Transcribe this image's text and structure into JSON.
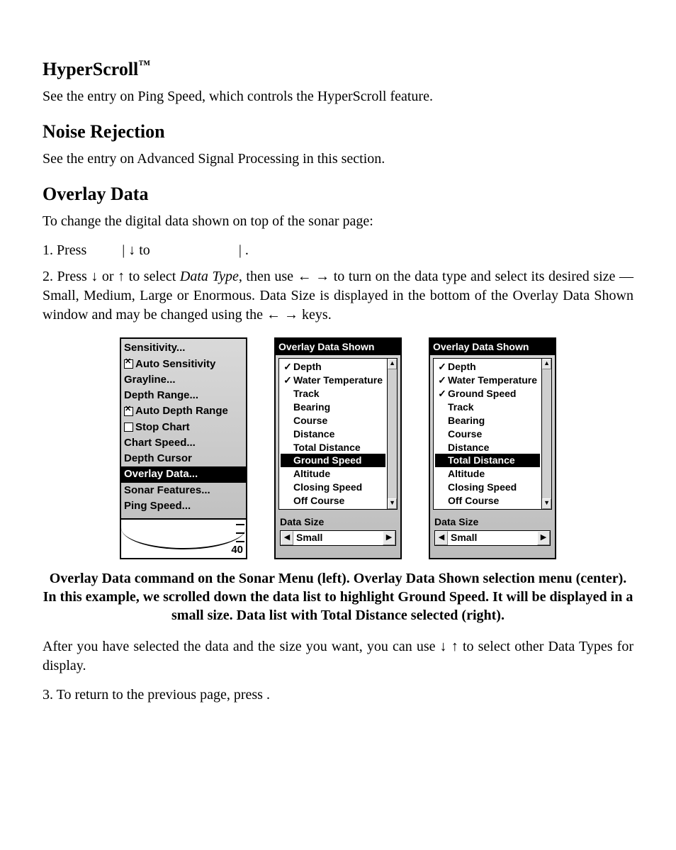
{
  "headings": {
    "hyperscroll": "HyperScroll",
    "tm": "™",
    "noise": "Noise Rejection",
    "overlay": "Overlay Data"
  },
  "paragraphs": {
    "hyperscroll_body": "See the entry on Ping Speed, which controls the HyperScroll feature.",
    "noise_body": "See the entry on Advanced Signal Processing in this section.",
    "overlay_intro": "To change the digital data shown on top of the sonar page:",
    "step1_a": "1. Press ",
    "step1_b": "|",
    "step1_c": "↓ to ",
    "step1_d": "|",
    "step1_e": "     .",
    "step2_a": "2. Press ↓ or ↑ to select ",
    "step2_datatype": "Data Type",
    "step2_b": ", then use ← → to turn on the data type and select its desired size — Small, Medium, Large or Enormous. Data Size is displayed in the bottom of the Overlay Data Shown window and may be changed using the ← → keys.",
    "after_a": "After you have selected the data and the size you want, you can use ↓ ↑ to select other Data Types for display.",
    "step3": "3. To return to the previous page, press       ."
  },
  "caption": "Overlay Data command on the Sonar Menu (left). Overlay Data Shown selection menu (center). In this example, we scrolled down the data list to highlight Ground Speed. It will be displayed in a small size. Data list with Total Distance selected (right).",
  "sonar_menu": {
    "items": [
      {
        "label": "Sensitivity...",
        "checkbox": null
      },
      {
        "label": "Auto Sensitivity",
        "checkbox": true
      },
      {
        "label": "Grayline...",
        "checkbox": null
      },
      {
        "label": "Depth Range...",
        "checkbox": null
      },
      {
        "label": "Auto Depth Range",
        "checkbox": true
      },
      {
        "label": "Stop Chart",
        "checkbox": false
      },
      {
        "label": "Chart Speed...",
        "checkbox": null
      },
      {
        "label": "Depth Cursor",
        "checkbox": null
      },
      {
        "label": "Overlay Data...",
        "checkbox": null,
        "selected": true
      },
      {
        "label": "Sonar Features...",
        "checkbox": null
      },
      {
        "label": "Ping Speed...",
        "checkbox": null
      }
    ],
    "depth_number": "40"
  },
  "overlay_center": {
    "title": "Overlay Data Shown",
    "items": [
      {
        "label": "Depth",
        "checked": true
      },
      {
        "label": "Water Temperature",
        "checked": true
      },
      {
        "label": "Track",
        "checked": false
      },
      {
        "label": "Bearing",
        "checked": false
      },
      {
        "label": "Course",
        "checked": false
      },
      {
        "label": "Distance",
        "checked": false
      },
      {
        "label": "Total Distance",
        "checked": false
      },
      {
        "label": "Ground Speed",
        "checked": false,
        "selected": true
      },
      {
        "label": "Altitude",
        "checked": false
      },
      {
        "label": "Closing Speed",
        "checked": false
      },
      {
        "label": "Off Course",
        "checked": false
      }
    ],
    "size_label": "Data Size",
    "size_value": "Small"
  },
  "overlay_right": {
    "title": "Overlay Data Shown",
    "items": [
      {
        "label": "Depth",
        "checked": true
      },
      {
        "label": "Water Temperature",
        "checked": true
      },
      {
        "label": "Ground Speed",
        "checked": true
      },
      {
        "label": "Track",
        "checked": false
      },
      {
        "label": "Bearing",
        "checked": false
      },
      {
        "label": "Course",
        "checked": false
      },
      {
        "label": "Distance",
        "checked": false
      },
      {
        "label": "Total Distance",
        "checked": false,
        "selected": true
      },
      {
        "label": "Altitude",
        "checked": false
      },
      {
        "label": "Closing Speed",
        "checked": false
      },
      {
        "label": "Off Course",
        "checked": false
      }
    ],
    "size_label": "Data Size",
    "size_value": "Small"
  },
  "arrows": {
    "up": "▲",
    "down": "▼",
    "left": "◀",
    "right": "▶"
  }
}
